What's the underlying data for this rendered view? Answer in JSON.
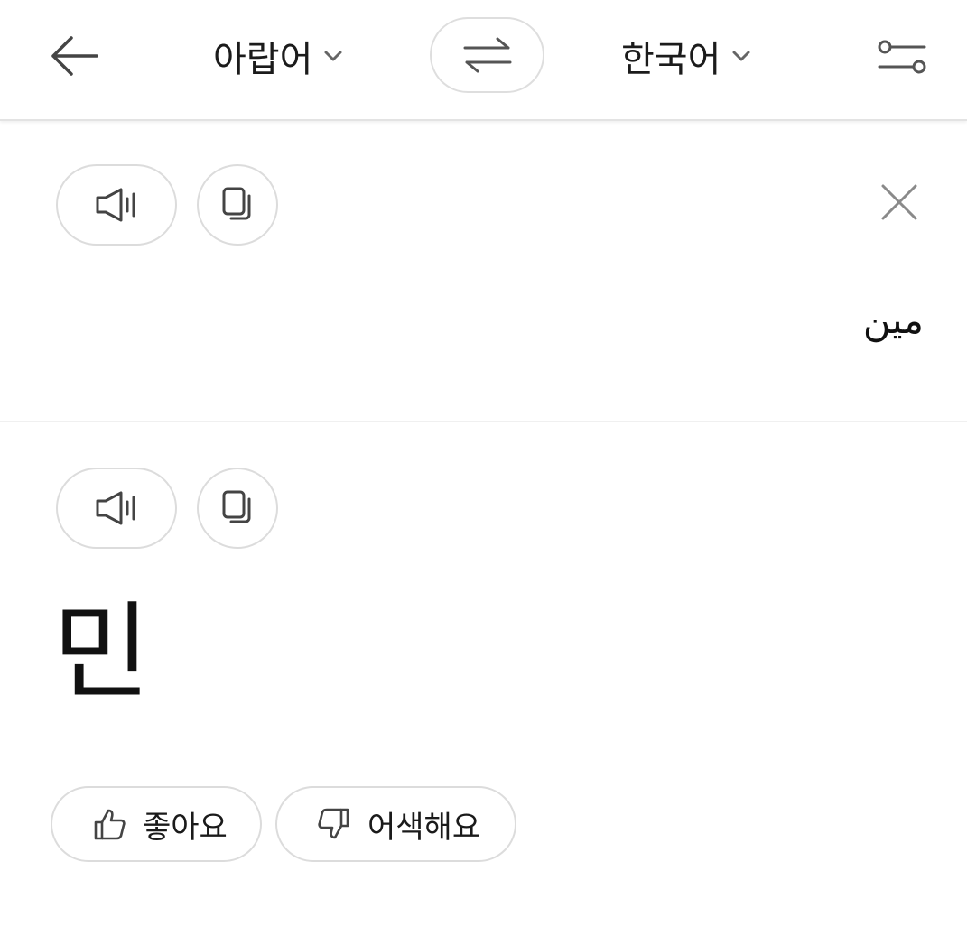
{
  "header": {
    "source_language": "아랍어",
    "target_language": "한국어",
    "icons": {
      "back": "arrow-left-icon",
      "swap": "swap-arrows-icon",
      "settings": "sliders-icon",
      "chevron": "chevron-down-icon"
    }
  },
  "source": {
    "text": "مين",
    "icons": {
      "speak": "speaker-icon",
      "copy": "copy-icon",
      "clear": "close-icon"
    }
  },
  "result": {
    "text": "민",
    "icons": {
      "speak": "speaker-icon",
      "copy": "copy-icon"
    }
  },
  "feedback": {
    "like_label": "좋아요",
    "dislike_label": "어색해요",
    "icons": {
      "like": "thumbs-up-icon",
      "dislike": "thumbs-down-icon"
    }
  },
  "colors": {
    "icon": "#555555",
    "border": "#dcdcdc",
    "text": "#1a1a1a"
  }
}
